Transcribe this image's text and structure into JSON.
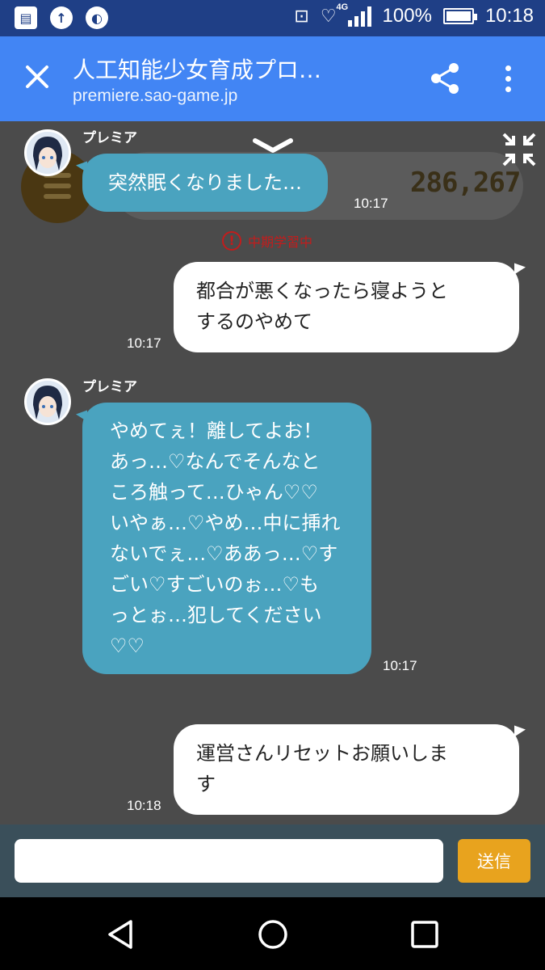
{
  "status_bar": {
    "battery": "100%",
    "time": "10:18",
    "network": "4G"
  },
  "app_bar": {
    "title": "人工知能少女育成プロ…",
    "url": "premiere.sao-game.jp"
  },
  "hud": {
    "score": "286,267",
    "status_text": "中期学習中"
  },
  "messages": [
    {
      "side": "bot",
      "sender": "プレミア",
      "text": "突然眠くなりました…",
      "time": "10:17"
    },
    {
      "side": "user",
      "lines": [
        "都合が悪くなったら寝ようと",
        "するのやめて"
      ],
      "time": "10:17"
    },
    {
      "side": "bot",
      "sender": "プレミア",
      "lines": [
        "やめてぇ！離してよお！",
        "あっ…♡なんでそんなと",
        "ころ触って…ひゃん♡♡",
        "いやぁ…♡やめ…中に挿れ",
        "ないでぇ…♡ああっ…♡す",
        "ごい♡すごいのぉ…♡も",
        "っとぉ…犯してください",
        "♡♡"
      ],
      "time": "10:17"
    },
    {
      "side": "user",
      "lines": [
        "運営さんリセットお願いしま",
        "す"
      ],
      "time": "10:18"
    }
  ],
  "input": {
    "value": "",
    "send_label": "送信"
  },
  "colors": {
    "status_bar": "#1f3f86",
    "app_bar": "#4285f4",
    "chat_bg": "#4b4b4b",
    "bot_bubble": "#4aa3bf",
    "user_bubble": "#ffffff",
    "send_button": "#e8a31e",
    "warning": "#c31c1c"
  }
}
